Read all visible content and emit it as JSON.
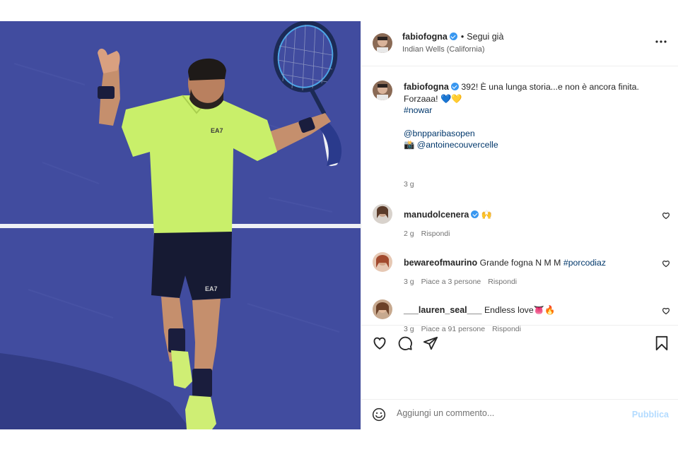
{
  "post": {
    "author": "fabiofogna",
    "follow_label": "Segui già",
    "location": "Indian Wells (California)",
    "more_icon": "more-horizontal-icon"
  },
  "caption": {
    "author": "fabiofogna",
    "line1": "392! È una lunga storia...e non è ancora finita.",
    "line2": "Forzaaa! 💙💛",
    "hashtag": "#nowar",
    "mention": "@bnpparibasopen",
    "credit": "📸 @antoinecouvercelle",
    "time": "3 g"
  },
  "comments": [
    {
      "user": "manudolcenera",
      "verified": true,
      "text": "🙌",
      "time": "2 g",
      "likes": "",
      "reply": "Rispondi"
    },
    {
      "user": "bewareofmaurino",
      "verified": false,
      "text": "Grande fogna N M M",
      "tag": "#porcodiaz",
      "time": "3 g",
      "likes": "Piace a 3 persone",
      "reply": "Rispondi"
    },
    {
      "user": "___lauren_seal___",
      "verified": false,
      "text": "Endless love👅🔥",
      "time": "3 g",
      "likes": "Piace a 91 persone",
      "reply": "Rispondi"
    }
  ],
  "actions": {
    "like_icon": "heart-icon",
    "comment_icon": "comment-icon",
    "share_icon": "share-icon",
    "save_icon": "bookmark-icon"
  },
  "compose": {
    "placeholder": "Aggiungi un commento...",
    "publish_label": "Pubblica"
  },
  "colors": {
    "court": "#414c9f",
    "shirt": "#c9ef6a",
    "verified": "#3897f0",
    "link": "#00376b",
    "publish_disabled": "#b3dbff"
  }
}
